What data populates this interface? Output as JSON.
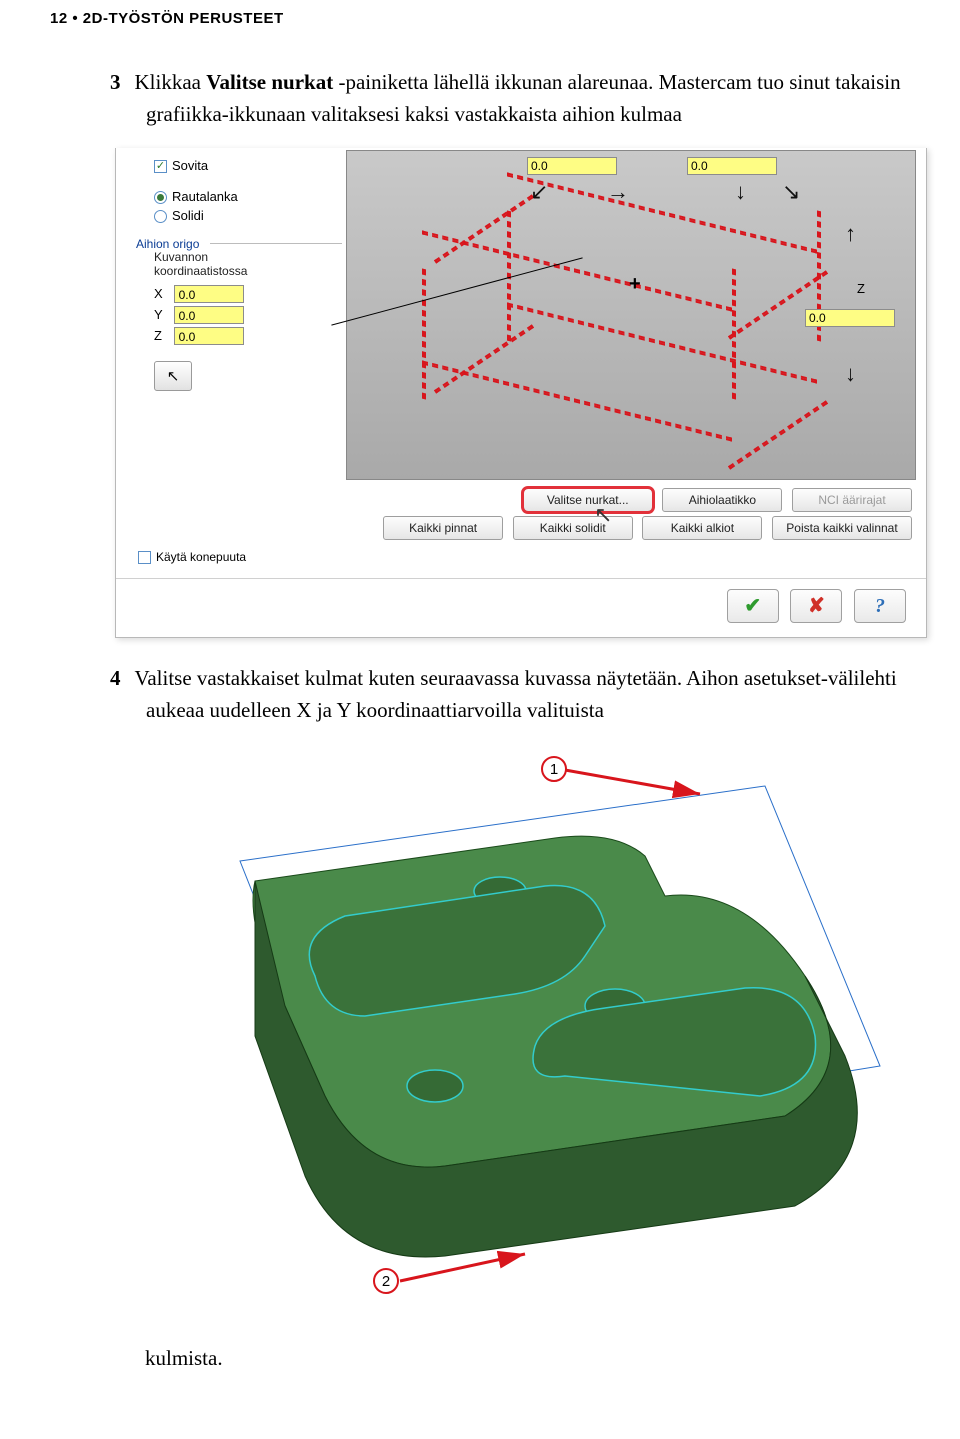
{
  "header": "12 • 2D-TYÖSTÖN PERUSTEET",
  "step3": {
    "num": "3",
    "pre": "Klikkaa ",
    "bold": "Valitse nurkat",
    "post": " -painiketta lähellä ikkunan alareunaa. Mastercam tuo sinut takaisin grafiikka-ikkunaan valitaksesi kaksi vastakkaista aihion kulmaa"
  },
  "dialog": {
    "sovita_check": "✓",
    "sovita": "Sovita",
    "rautalanka": "Rautalanka",
    "solidi": "Solidi",
    "aihion_origo": "Aihion origo",
    "kuvannon1": "Kuvannon",
    "kuvannon2": "koordinaatistossa",
    "X": "X",
    "Y": "Y",
    "Z": "Z",
    "xv": "0.0",
    "yv": "0.0",
    "zv": "0.0",
    "dim_top1": "0.0",
    "dim_top2": "0.0",
    "z_label": "Z",
    "z_val": "0.0",
    "btn_valitse_nurkat": "Valitse nurkat...",
    "btn_aihiolaatikko": "Aihiolaatikko",
    "btn_nci": "NCI äärirajat",
    "btn_kaikki_pinnat": "Kaikki pinnat",
    "btn_kaikki_solidit": "Kaikki solidit",
    "btn_kaikki_alkiot": "Kaikki alkiot",
    "btn_poista": "Poista kaikki valinnat",
    "kayta_konepuuta": "Käytä konepuuta"
  },
  "step4": {
    "num": "4",
    "text": "Valitse vastakkaiset kulmat kuten seuraavassa kuvassa näytetään. Aihon asetukset-välilehti aukeaa uudelleen X ja Y koordinaattiarvoilla valituista"
  },
  "callout1": "1",
  "callout2": "2",
  "lastword": "kulmista."
}
